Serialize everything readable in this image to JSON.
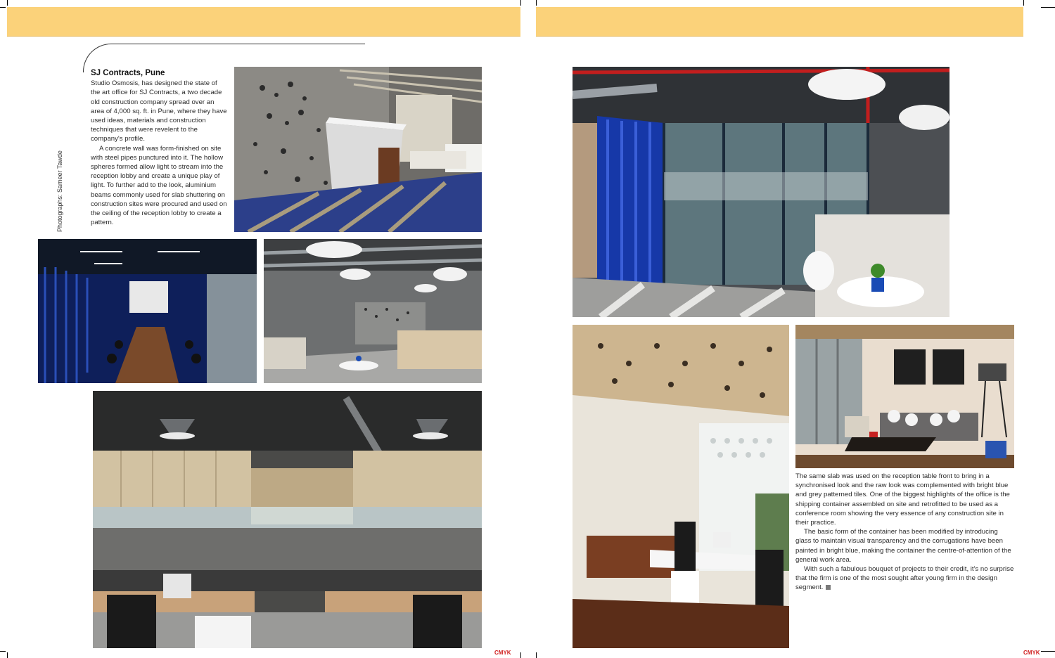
{
  "left_page": {
    "article": {
      "title": "SJ Contracts, Pune",
      "paragraph_1": "Studio Osmosis, has designed the state of the art office for SJ Contracts, a two decade old construction company spread over an area of 4,000 sq. ft. in Pune, where they have used ideas, materials and construction techniques that were revelent to the company's profile.",
      "paragraph_2": "A concrete wall was form-finished on site with steel pipes punctured into it. The hollow spheres formed allow light to stream into the reception lobby and create a unique play of light. To further add to the look, aluminium beams commonly used for slab shuttering on construction sites were procured and used on the ceiling of the reception lobby to create a pattern."
    },
    "photo_credit": "Photographs: Sameer Tawde"
  },
  "right_page": {
    "article": {
      "paragraph_1": "The same slab was used on the reception table front to bring in a synchronised look and the raw look was complemented with bright blue and grey patterned tiles. One of the biggest highlights of the office is the shipping container assembled on site and retrofitted to be used as a conference room showing the very essence of any construction site in their practice.",
      "paragraph_2": "The basic form of the container has been modified by introducing glass to maintain visual transparency and the corrugations have been painted in bright blue, making the container the centre-of-attention of the general work area.",
      "paragraph_3": "With such a fabulous bouquet of projects to their credit, it's no surprise that the firm is one of the most sought after young firm in the design segment."
    }
  },
  "cmyk_mark": "CMYK",
  "colors": {
    "header_band": "#fbd27a",
    "container_blue": "#1c3fa0",
    "floor_grey": "#8a8a8a"
  }
}
